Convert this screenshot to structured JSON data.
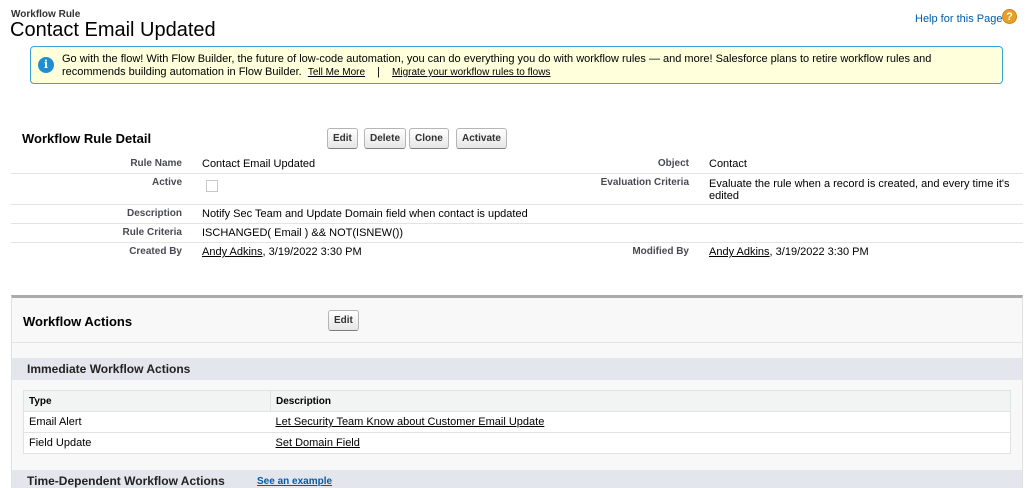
{
  "header": {
    "subtitle": "Workflow Rule",
    "title": "Contact Email Updated",
    "help_link": "Help for this Page",
    "help_icon": "help-icon"
  },
  "banner": {
    "text": "Go with the flow! With Flow Builder, the future of low-code automation, you can do everything you do with workflow rules — and more! Salesforce plans to retire workflow rules and recommends building automation in Flow Builder.",
    "link_tell_me": "Tell Me More",
    "separator": "|",
    "link_migrate": "Migrate your workflow rules to flows",
    "icon": "info-icon"
  },
  "detail": {
    "section_title": "Workflow Rule Detail",
    "buttons": {
      "edit": "Edit",
      "delete": "Delete",
      "clone": "Clone",
      "activate": "Activate"
    },
    "rule_name_label": "Rule Name",
    "rule_name": "Contact Email Updated",
    "object_label": "Object",
    "object": "Contact",
    "active_label": "Active",
    "active": false,
    "evaluation_label": "Evaluation Criteria",
    "evaluation": "Evaluate the rule when a record is created, and every time it's edited",
    "description_label": "Description",
    "description": "Notify Sec Team and Update Domain field when contact is updated",
    "criteria_label": "Rule Criteria",
    "criteria": "ISCHANGED( Email ) && NOT(ISNEW())",
    "created_by_label": "Created By",
    "created_by_user": "Andy Adkins",
    "created_by_date": ", 3/19/2022 3:30 PM",
    "modified_by_label": "Modified By",
    "modified_by_user": "Andy Adkins",
    "modified_by_date": ", 3/19/2022 3:30 PM"
  },
  "actions": {
    "section_title": "Workflow Actions",
    "edit_button": "Edit",
    "immediate_title": "Immediate Workflow Actions",
    "columns": [
      "Type",
      "Description"
    ],
    "rows": [
      {
        "type": "Email Alert",
        "description": "Let Security Team Know about Customer Email Update"
      },
      {
        "type": "Field Update",
        "description": "Set Domain Field"
      }
    ],
    "time_dependent_title": "Time-Dependent Workflow Actions",
    "see_example": "See an example"
  },
  "colors": {
    "link_blue": "#015ba7",
    "banner_bg": "#ffffdc",
    "banner_border": "#39a3d6",
    "sub_bar": "#e3e6ec"
  }
}
